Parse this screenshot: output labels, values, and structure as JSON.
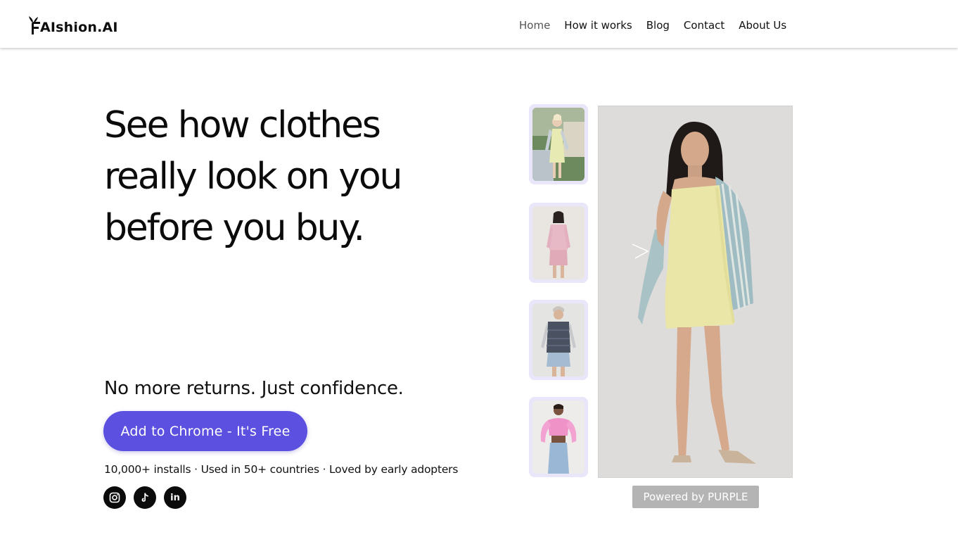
{
  "brand": {
    "logo_text": "AIshion.AI"
  },
  "nav": {
    "items": [
      {
        "label": "Home",
        "active": true
      },
      {
        "label": "How it works",
        "active": false
      },
      {
        "label": "Blog",
        "active": false
      },
      {
        "label": "Contact",
        "active": false
      },
      {
        "label": "About Us",
        "active": false
      }
    ]
  },
  "hero": {
    "headline_lines": [
      "See how clothes",
      "really look on you",
      "before you buy."
    ],
    "subheadline": "No more returns. Just confidence.",
    "cta_label": "Add to Chrome - It's Free",
    "stats": "10,000+ installs · Used in 50+ countries · Loved by early adopters"
  },
  "socials": [
    {
      "name": "instagram-icon"
    },
    {
      "name": "tiktok-icon"
    },
    {
      "name": "linkedin-icon",
      "text": "in"
    }
  ],
  "gallery": {
    "thumbnails": [
      {
        "name": "yellow-dress-outfit"
      },
      {
        "name": "pink-blazer-outfit"
      },
      {
        "name": "puffer-vest-outfit"
      },
      {
        "name": "pink-top-outfit"
      }
    ],
    "powered_by": "Powered by PURPLE"
  },
  "colors": {
    "accent": "#5b50df",
    "thumb_bg": "#e8e6f8",
    "powered_bg": "#b4b4b4"
  }
}
